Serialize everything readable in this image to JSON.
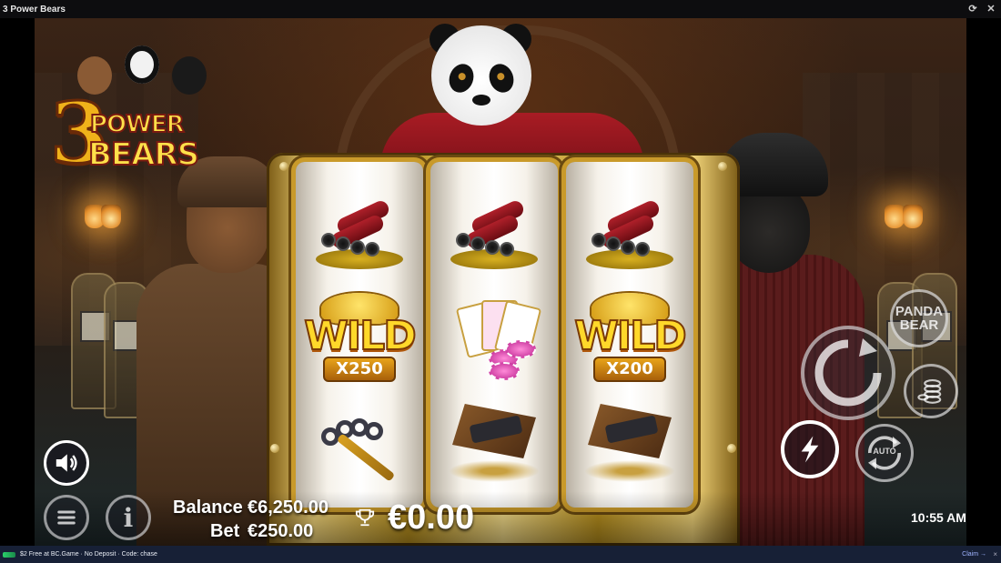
{
  "window": {
    "title": "3 Power Bears"
  },
  "game": {
    "logo": {
      "line1": "3",
      "line2": "POWER",
      "line3": "BEARS"
    },
    "reels": [
      {
        "symbols": [
          "dynamite",
          "wild",
          "brass-knuckles"
        ],
        "wild_label": "WILD",
        "wild_multiplier": "X250"
      },
      {
        "symbols": [
          "dynamite",
          "cards-chips",
          "revolver"
        ]
      },
      {
        "symbols": [
          "dynamite",
          "wild",
          "revolver"
        ],
        "wild_label": "WILD",
        "wild_multiplier": "X200"
      }
    ],
    "buttons": {
      "panda_bear_line1": "PANDA",
      "panda_bear_line2": "BEAR",
      "auto_label": "AUTO",
      "spin_icon": "spin-arrow-icon",
      "turbo_icon": "lightning-icon",
      "sound_icon": "speaker-icon",
      "menu_icon": "hamburger-icon",
      "info_icon": "i"
    },
    "hud": {
      "balance_label": "Balance",
      "balance_value": "€6,250.00",
      "bet_label": "Bet",
      "bet_value": "€250.00",
      "win_value": "€0.00",
      "clock": "10:55 AM"
    }
  },
  "promo_bar": {
    "text": "$2 Free at BC.Game · No Deposit · Code: chase",
    "claim": "Claim →",
    "close": "×"
  },
  "colors": {
    "gold": "#f0b21a",
    "wild_text": "#ffd82a",
    "robe_red": "#a81c24",
    "bar_bg": "#172036"
  }
}
